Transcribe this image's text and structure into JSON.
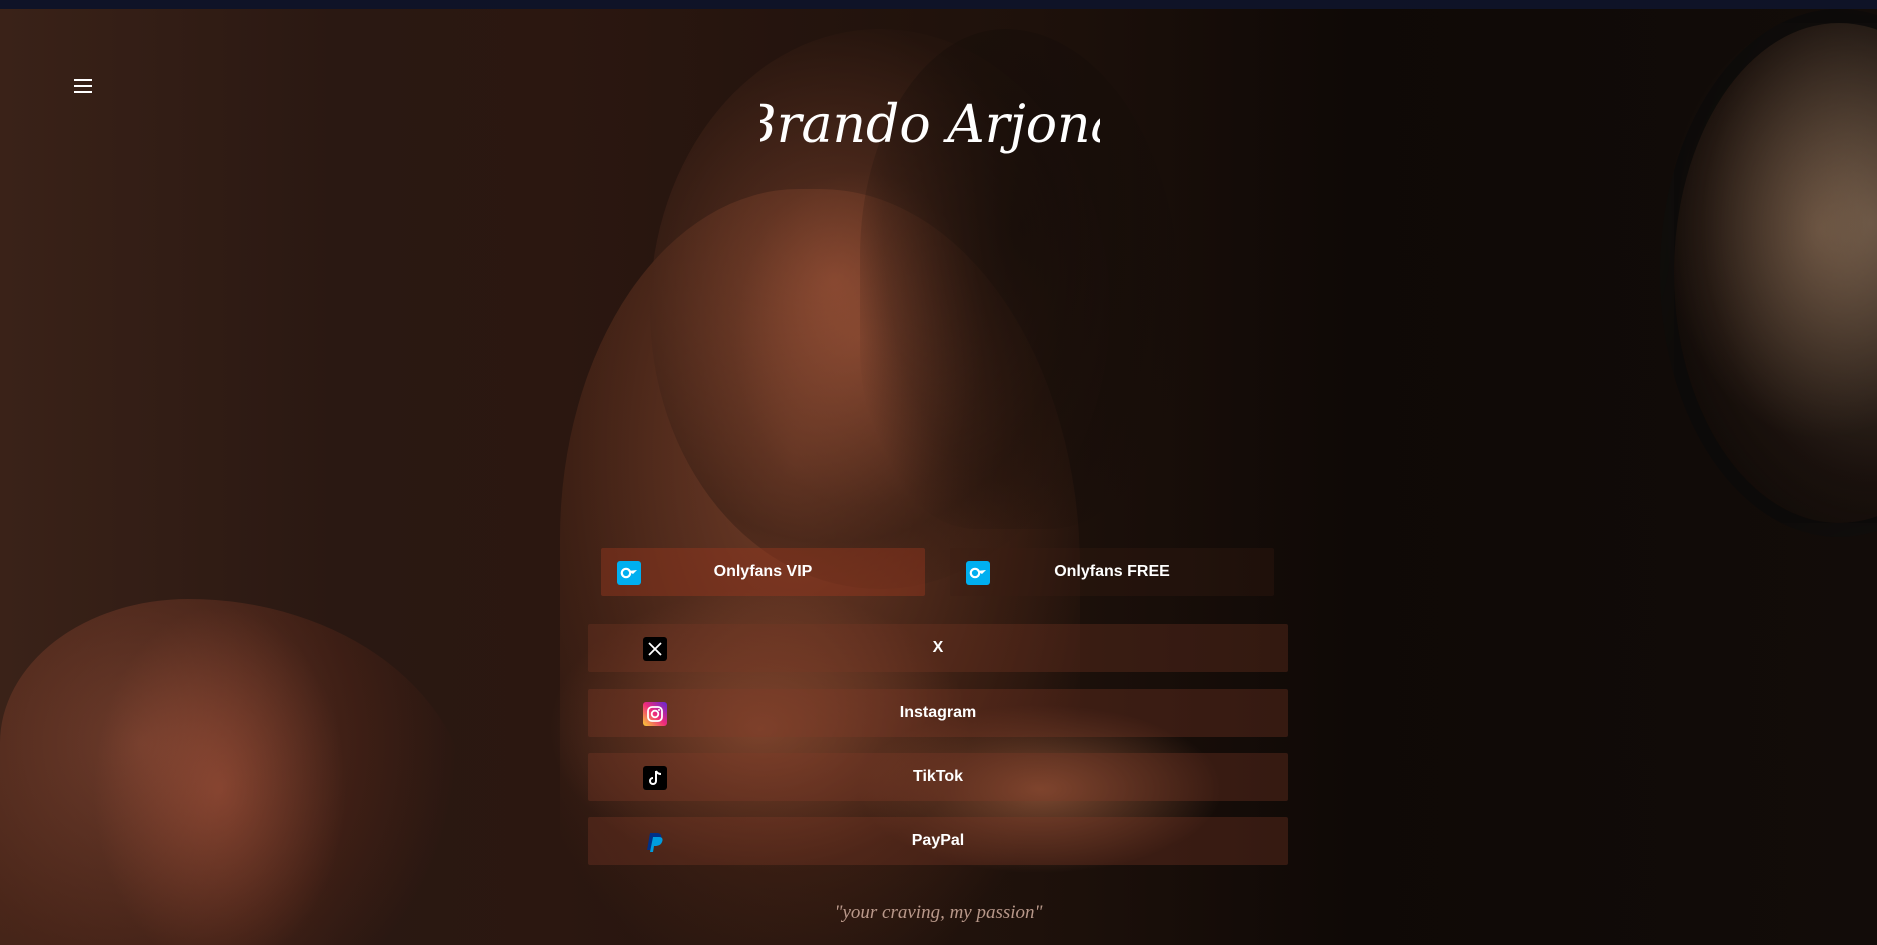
{
  "header": {
    "menu_icon": "hamburger-menu-icon",
    "logo_text": "Brando Arjona"
  },
  "links": [
    {
      "label": "Onlyfans VIP",
      "icon": "onlyfans-icon",
      "color": "#00aff0"
    },
    {
      "label": "Onlyfans FREE",
      "icon": "onlyfans-icon",
      "color": "#00aff0"
    },
    {
      "label": "X",
      "icon": "x-icon",
      "color": "#000000"
    },
    {
      "label": "Instagram",
      "icon": "instagram-icon",
      "color": "#ee2a7b"
    },
    {
      "label": "TikTok",
      "icon": "tiktok-icon",
      "color": "#000000"
    },
    {
      "label": "PayPal",
      "icon": "paypal-icon",
      "color": "#003087"
    }
  ],
  "tagline": "\"your craving, my passion\"",
  "colors": {
    "top_bar": "#0f1327",
    "text": "#ffffff",
    "tagline": "#d2afa0"
  }
}
